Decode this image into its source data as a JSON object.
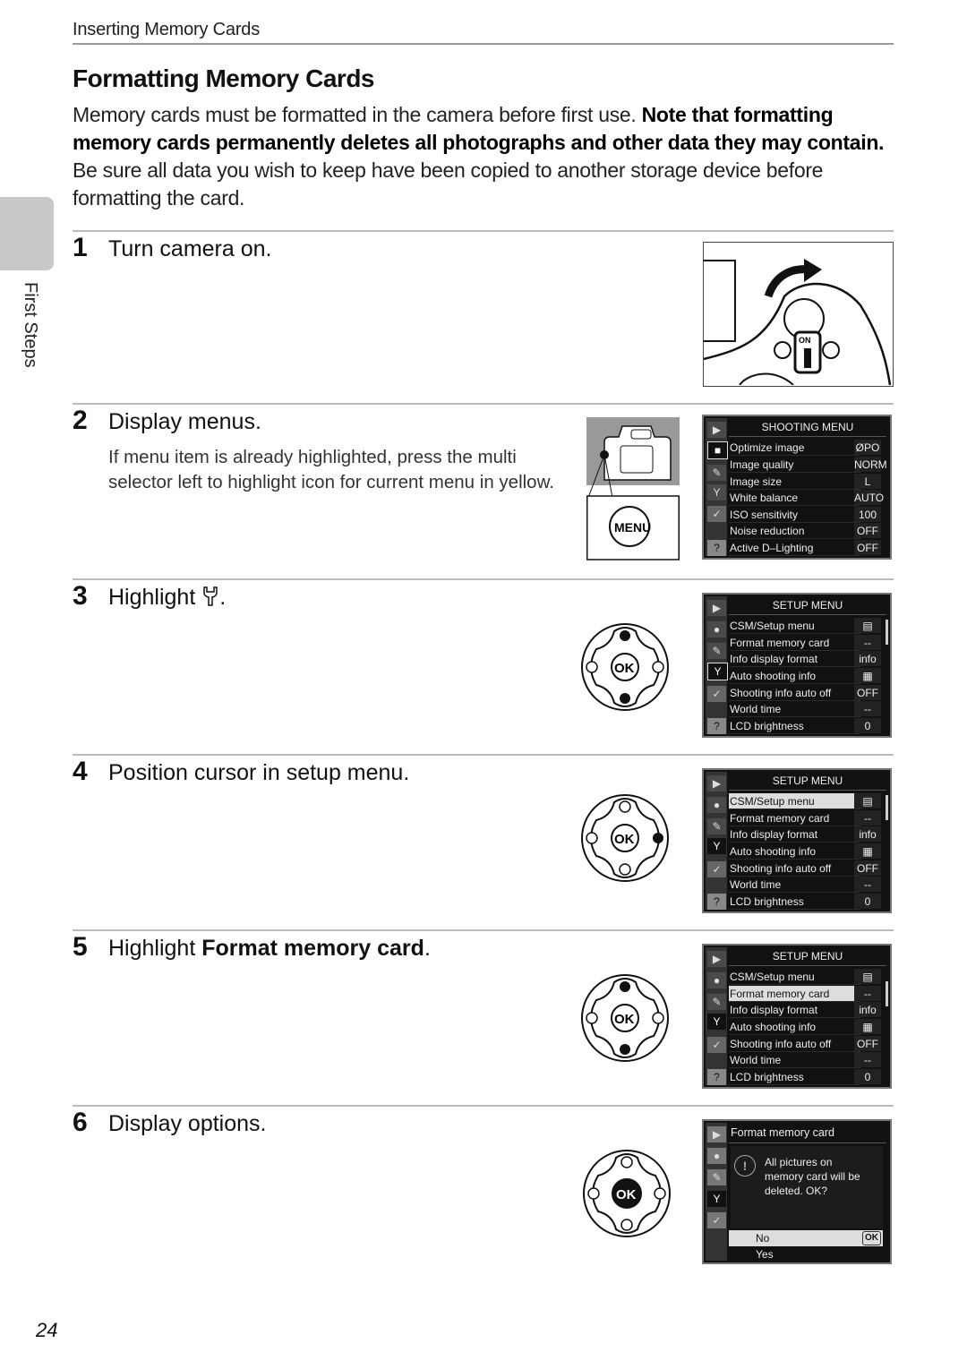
{
  "header": {
    "running_head": "Inserting Memory Cards",
    "side_tab_label": "First Steps"
  },
  "title": "Formatting Memory Cards",
  "intro": {
    "part1": "Memory cards must be formatted in the camera before first use. ",
    "bold": "Note that formatting memory cards permanently deletes all photographs and other data they may contain.",
    "part2": " Be sure all data you wish to keep have been copied to another storage device before formatting the card."
  },
  "steps": [
    {
      "num": "1",
      "title": "Turn camera on."
    },
    {
      "num": "2",
      "title": "Display menus.",
      "note": "If menu item is already highlighted, press the multi selector left to highlight icon for current menu in yellow."
    },
    {
      "num": "3",
      "title": "Highlight ",
      "icon_suffix": "."
    },
    {
      "num": "4",
      "title": "Position cursor in setup menu."
    },
    {
      "num": "5",
      "title_prefix": "Highlight ",
      "title_bold": "Format memory card",
      "title_suffix": "."
    },
    {
      "num": "6",
      "title": "Display options."
    }
  ],
  "illustrations": {
    "power_switch_label": "ON",
    "menu_button_label": "MENU",
    "ok_label": "OK"
  },
  "shooting_menu": {
    "title": "SHOOTING MENU",
    "items": [
      {
        "label": "Optimize image",
        "value": "ØPO"
      },
      {
        "label": "Image quality",
        "value": "NORM"
      },
      {
        "label": "Image size",
        "value": "L"
      },
      {
        "label": "White balance",
        "value": "AUTO"
      },
      {
        "label": "ISO sensitivity",
        "value": "100"
      },
      {
        "label": "Noise reduction",
        "value": "OFF"
      },
      {
        "label": "Active D–Lighting",
        "value": "OFF"
      }
    ]
  },
  "setup_menu": {
    "title": "SETUP MENU",
    "items": [
      {
        "label": "CSM/Setup menu",
        "value": "▤"
      },
      {
        "label": "Format memory card",
        "value": "--"
      },
      {
        "label": "Info display format",
        "value": "info"
      },
      {
        "label": "Auto shooting info",
        "value": "▦"
      },
      {
        "label": "Shooting info auto off",
        "value": "OFF"
      },
      {
        "label": "World time",
        "value": "--"
      },
      {
        "label": "LCD brightness",
        "value": "0"
      }
    ]
  },
  "format_dialog": {
    "title": "Format memory card",
    "message": "All pictures on memory card will be deleted. OK?",
    "options": [
      "No",
      "Yes"
    ],
    "ok_badge": "OK"
  },
  "menu_icons": [
    "playback-icon",
    "camera-icon",
    "pencil-icon",
    "wrench-icon",
    "retouch-icon",
    "help-icon"
  ],
  "page_number": "24"
}
